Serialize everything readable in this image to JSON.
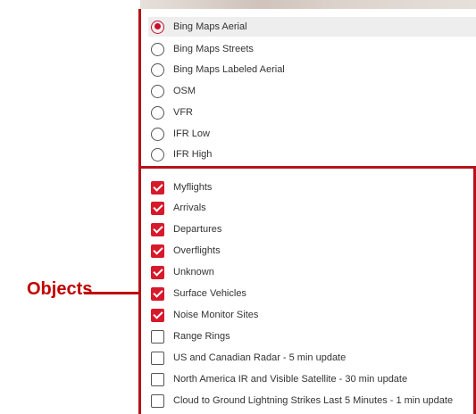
{
  "callout": {
    "text": "Objects",
    "color": "#c00000"
  },
  "accent_color": "#c8102e",
  "basemaps": [
    {
      "label": "Bing Maps Aerial",
      "selected": true
    },
    {
      "label": "Bing Maps Streets",
      "selected": false
    },
    {
      "label": "Bing Maps Labeled Aerial",
      "selected": false
    },
    {
      "label": "OSM",
      "selected": false
    },
    {
      "label": "VFR",
      "selected": false
    },
    {
      "label": "IFR Low",
      "selected": false
    },
    {
      "label": "IFR High",
      "selected": false
    }
  ],
  "objects": [
    {
      "label": "Myflights",
      "checked": true
    },
    {
      "label": "Arrivals",
      "checked": true
    },
    {
      "label": "Departures",
      "checked": true
    },
    {
      "label": "Overflights",
      "checked": true
    },
    {
      "label": "Unknown",
      "checked": true
    },
    {
      "label": "Surface Vehicles",
      "checked": true
    },
    {
      "label": "Noise Monitor Sites",
      "checked": true
    },
    {
      "label": "Range Rings",
      "checked": false
    },
    {
      "label": "US and Canadian Radar - 5 min update",
      "checked": false
    },
    {
      "label": "North America IR and Visible Satellite - 30 min update",
      "checked": false
    },
    {
      "label": "Cloud to Ground Lightning Strikes Last 5 Minutes - 1 min update",
      "checked": false
    }
  ]
}
